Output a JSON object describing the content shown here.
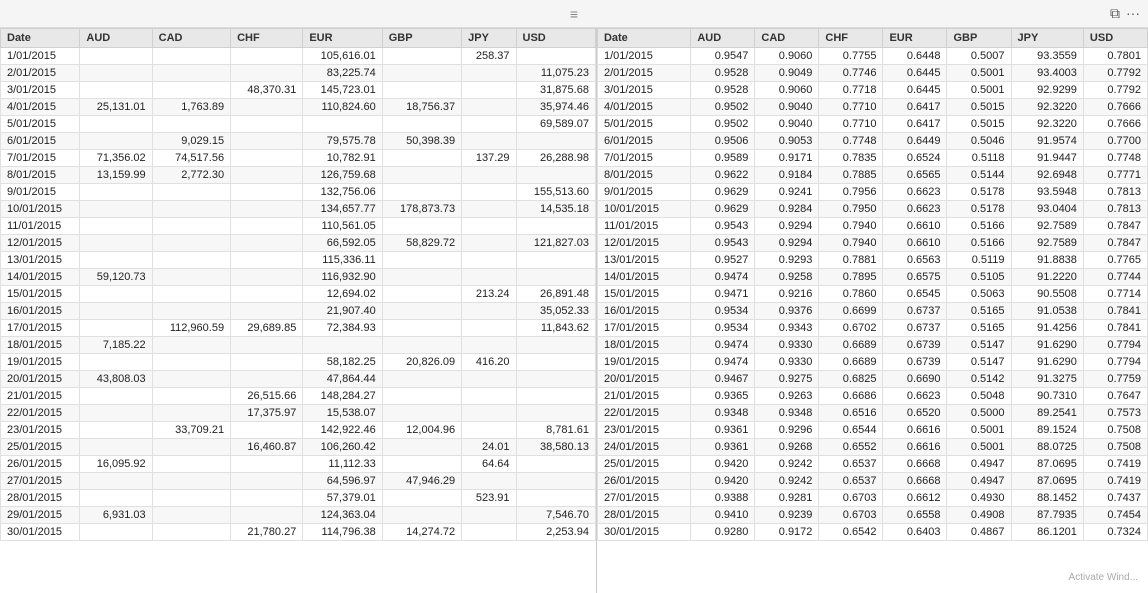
{
  "titleBar": {
    "handle": "≡",
    "restoreIcon": "⧉",
    "menuIcon": "···"
  },
  "leftTable": {
    "columns": [
      "Date",
      "AUD",
      "CAD",
      "CHF",
      "EUR",
      "GBP",
      "JPY",
      "USD"
    ],
    "rows": [
      [
        "1/01/2015",
        "",
        "",
        "",
        "105,616.01",
        "",
        "258.37",
        ""
      ],
      [
        "2/01/2015",
        "",
        "",
        "",
        "83,225.74",
        "",
        "",
        "11,075.23"
      ],
      [
        "3/01/2015",
        "",
        "",
        "48,370.31",
        "145,723.01",
        "",
        "",
        "31,875.68"
      ],
      [
        "4/01/2015",
        "25,131.01",
        "1,763.89",
        "",
        "110,824.60",
        "18,756.37",
        "",
        "35,974.46"
      ],
      [
        "5/01/2015",
        "",
        "",
        "",
        "",
        "",
        "",
        "69,589.07"
      ],
      [
        "6/01/2015",
        "",
        "9,029.15",
        "",
        "79,575.78",
        "50,398.39",
        "",
        ""
      ],
      [
        "7/01/2015",
        "71,356.02",
        "74,517.56",
        "",
        "10,782.91",
        "",
        "137.29",
        "26,288.98"
      ],
      [
        "8/01/2015",
        "13,159.99",
        "2,772.30",
        "",
        "126,759.68",
        "",
        "",
        ""
      ],
      [
        "9/01/2015",
        "",
        "",
        "",
        "132,756.06",
        "",
        "",
        "155,513.60"
      ],
      [
        "10/01/2015",
        "",
        "",
        "",
        "134,657.77",
        "178,873.73",
        "",
        "14,535.18"
      ],
      [
        "11/01/2015",
        "",
        "",
        "",
        "110,561.05",
        "",
        "",
        ""
      ],
      [
        "12/01/2015",
        "",
        "",
        "",
        "66,592.05",
        "58,829.72",
        "",
        "121,827.03"
      ],
      [
        "13/01/2015",
        "",
        "",
        "",
        "115,336.11",
        "",
        "",
        ""
      ],
      [
        "14/01/2015",
        "59,120.73",
        "",
        "",
        "116,932.90",
        "",
        "",
        ""
      ],
      [
        "15/01/2015",
        "",
        "",
        "",
        "12,694.02",
        "",
        "213.24",
        "26,891.48"
      ],
      [
        "16/01/2015",
        "",
        "",
        "",
        "21,907.40",
        "",
        "",
        "35,052.33"
      ],
      [
        "17/01/2015",
        "",
        "112,960.59",
        "29,689.85",
        "72,384.93",
        "",
        "",
        "11,843.62"
      ],
      [
        "18/01/2015",
        "7,185.22",
        "",
        "",
        "",
        "",
        "",
        ""
      ],
      [
        "19/01/2015",
        "",
        "",
        "",
        "58,182.25",
        "20,826.09",
        "416.20",
        ""
      ],
      [
        "20/01/2015",
        "43,808.03",
        "",
        "",
        "47,864.44",
        "",
        "",
        ""
      ],
      [
        "21/01/2015",
        "",
        "",
        "26,515.66",
        "148,284.27",
        "",
        "",
        ""
      ],
      [
        "22/01/2015",
        "",
        "",
        "17,375.97",
        "15,538.07",
        "",
        "",
        ""
      ],
      [
        "23/01/2015",
        "",
        "33,709.21",
        "",
        "142,922.46",
        "12,004.96",
        "",
        "8,781.61"
      ],
      [
        "25/01/2015",
        "",
        "",
        "16,460.87",
        "106,260.42",
        "",
        "24.01",
        "38,580.13"
      ],
      [
        "26/01/2015",
        "16,095.92",
        "",
        "",
        "11,112.33",
        "",
        "64.64",
        ""
      ],
      [
        "27/01/2015",
        "",
        "",
        "",
        "64,596.97",
        "47,946.29",
        "",
        ""
      ],
      [
        "28/01/2015",
        "",
        "",
        "",
        "57,379.01",
        "",
        "523.91",
        ""
      ],
      [
        "29/01/2015",
        "6,931.03",
        "",
        "",
        "124,363.04",
        "",
        "",
        "7,546.70"
      ],
      [
        "30/01/2015",
        "",
        "",
        "21,780.27",
        "114,796.38",
        "14,274.72",
        "",
        "2,253.94"
      ]
    ]
  },
  "rightTable": {
    "columns": [
      "Date",
      "AUD",
      "CAD",
      "CHF",
      "EUR",
      "GBP",
      "JPY",
      "USD"
    ],
    "rows": [
      [
        "1/01/2015",
        "0.9547",
        "0.9060",
        "0.7755",
        "0.6448",
        "0.5007",
        "93.3559",
        "0.7801"
      ],
      [
        "2/01/2015",
        "0.9528",
        "0.9049",
        "0.7746",
        "0.6445",
        "0.5001",
        "93.4003",
        "0.7792"
      ],
      [
        "3/01/2015",
        "0.9528",
        "0.9060",
        "0.7718",
        "0.6445",
        "0.5001",
        "92.9299",
        "0.7792"
      ],
      [
        "4/01/2015",
        "0.9502",
        "0.9040",
        "0.7710",
        "0.6417",
        "0.5015",
        "92.3220",
        "0.7666"
      ],
      [
        "5/01/2015",
        "0.9502",
        "0.9040",
        "0.7710",
        "0.6417",
        "0.5015",
        "92.3220",
        "0.7666"
      ],
      [
        "6/01/2015",
        "0.9506",
        "0.9053",
        "0.7748",
        "0.6449",
        "0.5046",
        "91.9574",
        "0.7700"
      ],
      [
        "7/01/2015",
        "0.9589",
        "0.9171",
        "0.7835",
        "0.6524",
        "0.5118",
        "91.9447",
        "0.7748"
      ],
      [
        "8/01/2015",
        "0.9622",
        "0.9184",
        "0.7885",
        "0.6565",
        "0.5144",
        "92.6948",
        "0.7771"
      ],
      [
        "9/01/2015",
        "0.9629",
        "0.9241",
        "0.7956",
        "0.6623",
        "0.5178",
        "93.5948",
        "0.7813"
      ],
      [
        "10/01/2015",
        "0.9629",
        "0.9284",
        "0.7950",
        "0.6623",
        "0.5178",
        "93.0404",
        "0.7813"
      ],
      [
        "11/01/2015",
        "0.9543",
        "0.9294",
        "0.7940",
        "0.6610",
        "0.5166",
        "92.7589",
        "0.7847"
      ],
      [
        "12/01/2015",
        "0.9543",
        "0.9294",
        "0.7940",
        "0.6610",
        "0.5166",
        "92.7589",
        "0.7847"
      ],
      [
        "13/01/2015",
        "0.9527",
        "0.9293",
        "0.7881",
        "0.6563",
        "0.5119",
        "91.8838",
        "0.7765"
      ],
      [
        "14/01/2015",
        "0.9474",
        "0.9258",
        "0.7895",
        "0.6575",
        "0.5105",
        "91.2220",
        "0.7744"
      ],
      [
        "15/01/2015",
        "0.9471",
        "0.9216",
        "0.7860",
        "0.6545",
        "0.5063",
        "90.5508",
        "0.7714"
      ],
      [
        "16/01/2015",
        "0.9534",
        "0.9376",
        "0.6699",
        "0.6737",
        "0.5165",
        "91.0538",
        "0.7841"
      ],
      [
        "17/01/2015",
        "0.9534",
        "0.9343",
        "0.6702",
        "0.6737",
        "0.5165",
        "91.4256",
        "0.7841"
      ],
      [
        "18/01/2015",
        "0.9474",
        "0.9330",
        "0.6689",
        "0.6739",
        "0.5147",
        "91.6290",
        "0.7794"
      ],
      [
        "19/01/2015",
        "0.9474",
        "0.9330",
        "0.6689",
        "0.6739",
        "0.5147",
        "91.6290",
        "0.7794"
      ],
      [
        "20/01/2015",
        "0.9467",
        "0.9275",
        "0.6825",
        "0.6690",
        "0.5142",
        "91.3275",
        "0.7759"
      ],
      [
        "21/01/2015",
        "0.9365",
        "0.9263",
        "0.6686",
        "0.6623",
        "0.5048",
        "90.7310",
        "0.7647"
      ],
      [
        "22/01/2015",
        "0.9348",
        "0.9348",
        "0.6516",
        "0.6520",
        "0.5000",
        "89.2541",
        "0.7573"
      ],
      [
        "23/01/2015",
        "0.9361",
        "0.9296",
        "0.6544",
        "0.6616",
        "0.5001",
        "89.1524",
        "0.7508"
      ],
      [
        "24/01/2015",
        "0.9361",
        "0.9268",
        "0.6552",
        "0.6616",
        "0.5001",
        "88.0725",
        "0.7508"
      ],
      [
        "25/01/2015",
        "0.9420",
        "0.9242",
        "0.6537",
        "0.6668",
        "0.4947",
        "87.0695",
        "0.7419"
      ],
      [
        "26/01/2015",
        "0.9420",
        "0.9242",
        "0.6537",
        "0.6668",
        "0.4947",
        "87.0695",
        "0.7419"
      ],
      [
        "27/01/2015",
        "0.9388",
        "0.9281",
        "0.6703",
        "0.6612",
        "0.4930",
        "88.1452",
        "0.7437"
      ],
      [
        "28/01/2015",
        "0.9410",
        "0.9239",
        "0.6703",
        "0.6558",
        "0.4908",
        "87.7935",
        "0.7454"
      ],
      [
        "30/01/2015",
        "0.9280",
        "0.9172",
        "0.6542",
        "0.6403",
        "0.4867",
        "86.1201",
        "0.7324"
      ]
    ]
  },
  "watermark": "Activate Wind..."
}
